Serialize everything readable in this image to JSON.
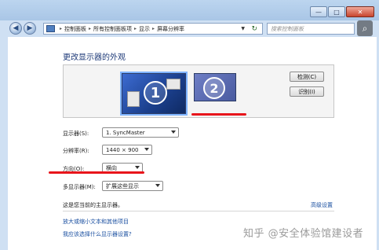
{
  "window": {
    "caption_buttons": [
      "—",
      "□",
      "✕"
    ]
  },
  "address_bar": {
    "crumbs": [
      "控制面板",
      "所有控制面板项",
      "显示",
      "屏幕分辨率"
    ]
  },
  "search": {
    "placeholder": "搜索控制面板"
  },
  "page": {
    "title": "更改显示器的外观"
  },
  "preview": {
    "monitors": [
      "1",
      "2"
    ],
    "detect_label": "检测(C)",
    "identify_label": "识别(I)"
  },
  "settings": {
    "display_label": "显示器(S):",
    "display_value": "1. SyncMaster",
    "resolution_label": "分辨率(R):",
    "resolution_value": "1440 × 900",
    "orientation_label": "方向(O):",
    "orientation_value": "横向",
    "multi_label": "多显示器(M):",
    "multi_value": "扩展这些显示"
  },
  "status": {
    "main_display_text": "这是您当前的主显示器。",
    "advanced_link": "高级设置"
  },
  "links": {
    "text_size": "放大或缩小文本和其他项目",
    "which_settings": "我应该选择什么显示器设置?"
  },
  "watermark": "知乎 @安全体验馆建设者",
  "colors": {
    "annotation_red": "#e8151b",
    "link_blue": "#1a4fa0"
  }
}
